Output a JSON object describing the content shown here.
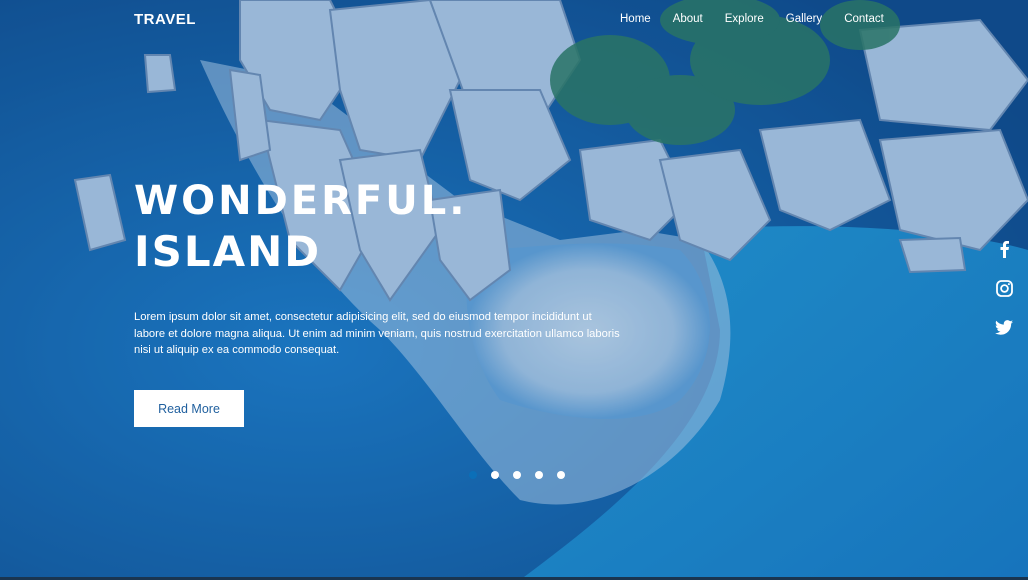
{
  "brand": {
    "logo": "TRAVEL"
  },
  "nav": {
    "items": [
      "Home",
      "About",
      "Explore",
      "Gallery",
      "Contact"
    ]
  },
  "hero": {
    "headline_line1": "WONDERFUL.",
    "headline_line2": "ISLAND",
    "paragraph_line1": "Lorem ipsum dolor sit amet, consectetur adipisicing elit, sed do eiusmod tempor incididunt ut",
    "paragraph_line2": "labore et dolore magna aliqua. Ut enim ad minim veniam, quis nostrud exercitation ullamco laboris",
    "paragraph_line3": "nisi ut aliquip ex ea commodo consequat.",
    "button_label": "Read More"
  },
  "social": {
    "icons": [
      "facebook-icon",
      "instagram-icon",
      "twitter-icon"
    ]
  },
  "slider": {
    "dot_count": 5,
    "active_index": 0
  },
  "colors": {
    "ocean": "#0f5c9c",
    "button_text": "#1f5f9e",
    "accent": "#0b6fb8"
  }
}
